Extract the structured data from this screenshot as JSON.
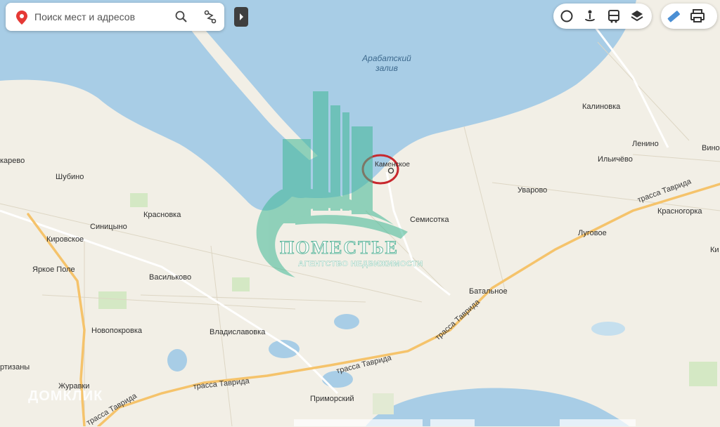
{
  "search": {
    "placeholder": "Поиск мест и адресов"
  },
  "icons": {
    "pin": "map-pin-icon",
    "search": "search-icon",
    "route": "route-icon",
    "collapse": "panel-expand-icon",
    "layers": [
      "circle-layer-icon",
      "panorama-icon",
      "transit-icon",
      "layers-icon",
      "ruler-icon",
      "print-icon"
    ]
  },
  "water_labels": {
    "gulf": "Арабатский\nзалив"
  },
  "places": {
    "kamenskoe": "Каменское",
    "kalinovka": "Калиновка",
    "lenino": "Ленино",
    "vino": "Виног",
    "ilichevo": "Ильичёво",
    "uvarovo": "Уварово",
    "semisotka": "Семисотка",
    "krasnogorka": "Красногорка",
    "lugovoe": "Луговое",
    "ki": "Ки",
    "batalnoe": "Батальное",
    "karevo": "карево",
    "shubino": "Шубино",
    "krasnovka": "Красновка",
    "sinitsyno": "Синицыно",
    "kirovskoe": "Кировское",
    "yarkoe_pole": "Яркое Поле",
    "vasilkovoe": "Васильково",
    "novopokrovka": "Новопокровка",
    "vladislavovka": "Владиславовка",
    "partizany": "ртизаны",
    "zhuravki": "Журавки",
    "primorsky": "Приморский"
  },
  "roads": {
    "tavrida_ne": "трасса Таврида",
    "tavrida_mid": "трасса Таврида",
    "tavrida_s": "трасса Таврида",
    "tavrida_sw": "трасса Таврида",
    "tavrida_w": "трасса Таврида"
  },
  "watermark": {
    "title": "ПОМЕСТЬЕ",
    "subtitle": "АГЕНТСТВО НЕДВИЖИМОСТИ",
    "brand": "ДОМКЛИК"
  },
  "colors": {
    "water": "#a8cde6",
    "land": "#f2efe6",
    "road": "#f5c36b",
    "highlight_circle": "#c8282e",
    "watermark": "#3fb896"
  }
}
